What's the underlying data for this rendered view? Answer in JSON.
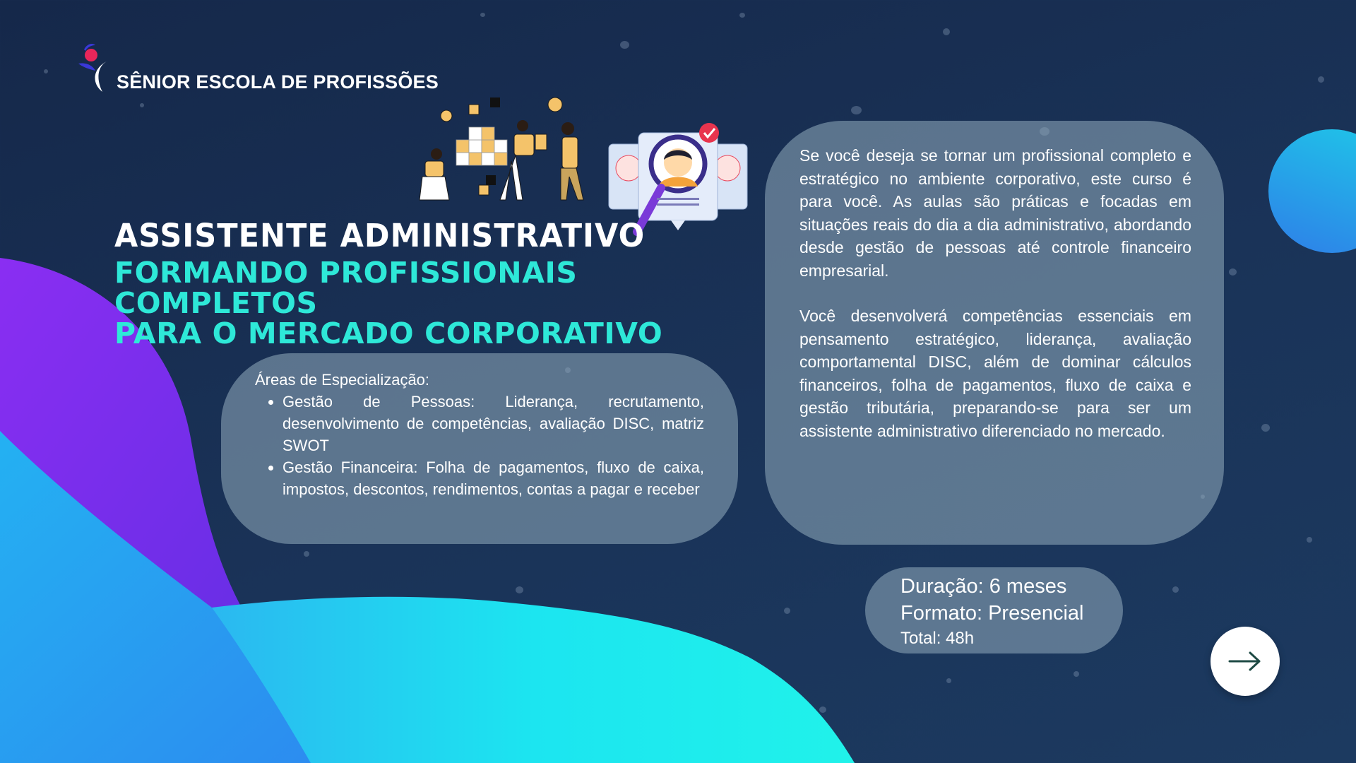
{
  "brand": {
    "name": "SÊNIOR ESCOLA DE PROFISSÕES",
    "logo_icon": "person-swoosh-logo-icon"
  },
  "heading": {
    "title": "ASSISTENTE ADMINISTRATIVO",
    "subtitle_line1": "FORMANDO PROFISSIONAIS COMPLETOS",
    "subtitle_line2": "PARA O MERCADO CORPORATIVO"
  },
  "areas": {
    "heading": "Áreas de Especialização:",
    "items": [
      "Gestão de Pessoas: Liderança, recrutamento, desenvolvimento de competências, avaliação DISC, matriz SWOT",
      "Gestão Financeira: Folha de pagamentos, fluxo de caixa, impostos, descontos, rendimentos, contas a pagar e receber"
    ]
  },
  "description": {
    "paragraph1": "Se você deseja se tornar um profissional completo e estratégico no ambiente corporativo, este curso é para você. As aulas são práticas e focadas em situações reais do dia a dia administrativo, abordando desde gestão de pessoas até controle financeiro empresarial.",
    "paragraph2": "Você desenvolverá competências essenciais em pensamento estratégico, liderança, avaliação comportamental DISC, além de dominar cálculos financeiros, folha de pagamentos, fluxo de caixa e gestão tributária, preparando-se para ser um assistente administrativo diferenciado no mercado."
  },
  "info": {
    "duration": "Duração: 6 meses",
    "format": "Formato: Presencial",
    "total": "Total: 48h"
  },
  "navigation": {
    "next_icon": "arrow-right-icon"
  },
  "colors": {
    "background": "#172d50",
    "accent_cyan": "#2ee8d8",
    "wave_purple": "#7b2cf0",
    "wave_cyan": "#1ee8f2",
    "card": "#7e97a8"
  }
}
